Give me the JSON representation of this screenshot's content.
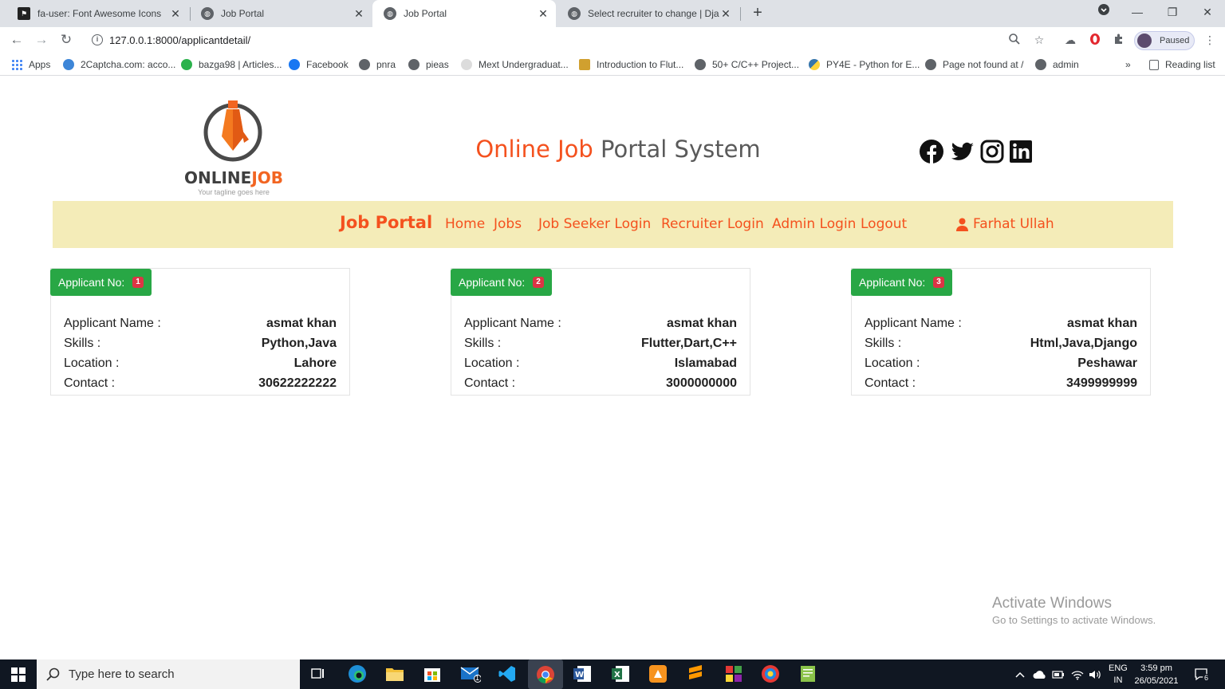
{
  "browser": {
    "tabs": [
      {
        "title": "fa-user: Font Awesome Icons",
        "active": false
      },
      {
        "title": "Job Portal",
        "active": false
      },
      {
        "title": "Job Portal",
        "active": true
      },
      {
        "title": "Select recruiter to change | Djang",
        "active": false
      }
    ],
    "url": "127.0.0.1:8000/applicantdetail/",
    "profile_label": "Paused",
    "bookmarks": [
      "Apps",
      "2Captcha.com: acco...",
      "bazga98 | Articles...",
      "Facebook",
      "pnra",
      "pieas",
      "Mext Undergraduat...",
      "Introduction to Flut...",
      "50+ C/C++ Project...",
      "PY4E - Python for E...",
      "Page not found at /",
      "admin"
    ],
    "overflow_label": "»",
    "reading_list": "Reading list"
  },
  "header": {
    "logo_text_main": "ONLINE",
    "logo_text_accent": "JOB",
    "logo_tagline": "Your tagline goes here",
    "title_accent": "Online Job",
    "title_rest": " Portal System",
    "social_icons": [
      "facebook-icon",
      "twitter-icon",
      "instagram-icon",
      "linkedin-icon"
    ]
  },
  "navbar": {
    "brand": "Job Portal",
    "links": [
      "Home",
      "Jobs",
      "Job Seeker Login",
      "Recruiter Login",
      "Admin Login",
      "Logout"
    ],
    "user": "Farhat Ullah"
  },
  "applicants": [
    {
      "badge_label": "Applicant No:",
      "number": "1",
      "fields": [
        {
          "label": "Applicant Name :",
          "value": "asmat khan"
        },
        {
          "label": "Skills :",
          "value": "Python,Java"
        },
        {
          "label": "Location :",
          "value": "Lahore"
        },
        {
          "label": "Contact :",
          "value": "30622222222"
        }
      ]
    },
    {
      "badge_label": "Applicant No:",
      "number": "2",
      "fields": [
        {
          "label": "Applicant Name :",
          "value": "asmat khan"
        },
        {
          "label": "Skills :",
          "value": "Flutter,Dart,C++"
        },
        {
          "label": "Location :",
          "value": "Islamabad"
        },
        {
          "label": "Contact :",
          "value": "3000000000"
        }
      ]
    },
    {
      "badge_label": "Applicant No:",
      "number": "3",
      "fields": [
        {
          "label": "Applicant Name :",
          "value": "asmat khan"
        },
        {
          "label": "Skills :",
          "value": "Html,Java,Django"
        },
        {
          "label": "Location :",
          "value": "Peshawar"
        },
        {
          "label": "Contact :",
          "value": "3499999999"
        }
      ]
    }
  ],
  "watermark": {
    "line1": "Activate Windows",
    "line2": "Go to Settings to activate Windows."
  },
  "taskbar": {
    "search_placeholder": "Type here to search",
    "lang_top": "ENG",
    "lang_bottom": "IN",
    "time": "3:59 pm",
    "date": "26/05/2021",
    "notification_count": "6",
    "mail_badge": "1"
  },
  "colors": {
    "accent": "#f4511e",
    "navbar_bg": "#f4ecb8",
    "badge_green": "#28a745",
    "badge_red": "#dc3545"
  }
}
